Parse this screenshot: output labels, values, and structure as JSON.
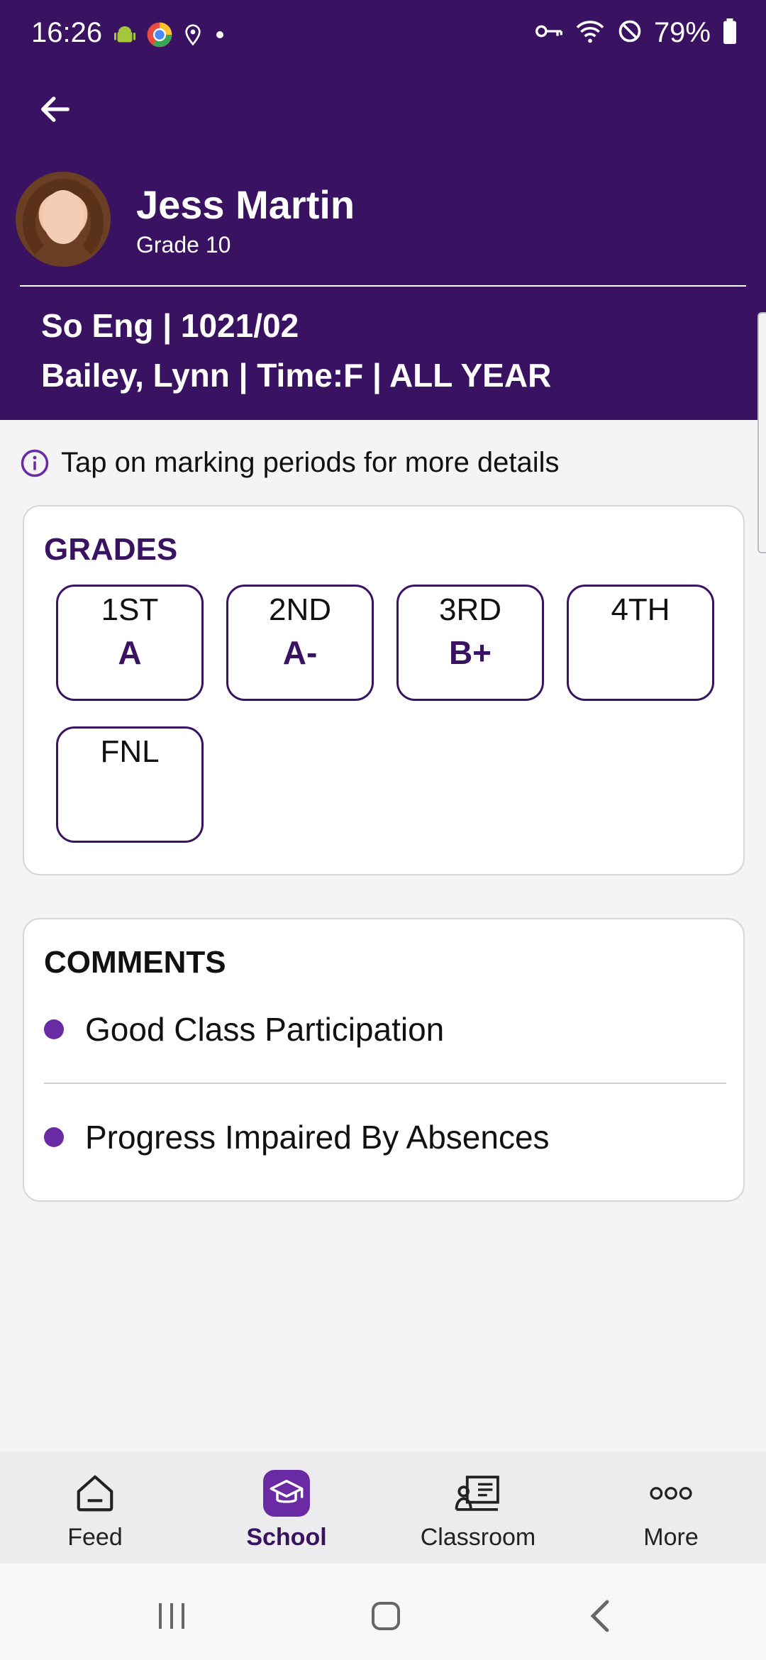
{
  "status_bar": {
    "time": "16:26",
    "battery": "79%",
    "icons_left": [
      "android-icon",
      "chrome-icon",
      "location-icon",
      "dot-icon"
    ],
    "icons_right": [
      "vpn-key-icon",
      "wifi-icon",
      "do-not-disturb-icon",
      "battery-icon"
    ]
  },
  "student": {
    "name": "Jess Martin",
    "grade": "Grade 10"
  },
  "course": {
    "line1": "So Eng | 1021/02",
    "line2": "Bailey, Lynn | Time:F | ALL YEAR"
  },
  "tip": {
    "text": "Tap on marking periods for more details"
  },
  "grades": {
    "title": "GRADES",
    "periods": [
      {
        "label": "1ST",
        "grade": "A"
      },
      {
        "label": "2ND",
        "grade": "A-"
      },
      {
        "label": "3RD",
        "grade": "B+"
      },
      {
        "label": "4TH",
        "grade": ""
      },
      {
        "label": "FNL",
        "grade": ""
      }
    ]
  },
  "comments": {
    "title": "COMMENTS",
    "items": [
      "Good Class Participation",
      "Progress Impaired By Absences"
    ]
  },
  "bottom_nav": {
    "items": [
      {
        "label": "Feed",
        "icon": "home-icon"
      },
      {
        "label": "School",
        "icon": "graduation-cap-icon",
        "active": true
      },
      {
        "label": "Classroom",
        "icon": "classroom-board-icon"
      },
      {
        "label": "More",
        "icon": "more-dots-icon"
      }
    ]
  },
  "colors": {
    "header_bg": "#3a1262",
    "accent": "#6a2aa3",
    "page_bg": "#f4f4f5"
  }
}
